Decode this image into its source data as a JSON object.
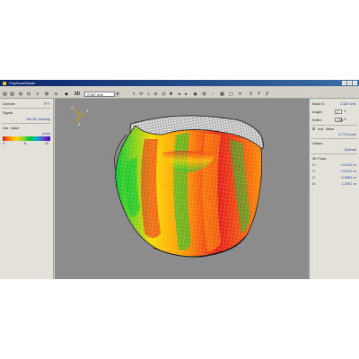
{
  "window": {
    "title": "PolyScanViewer"
  },
  "toolbar": {
    "band_select_value": "2.587 kHz",
    "axis_x": "X",
    "axis_y": "Y",
    "axis_z": "Z",
    "mode_3d": "3D"
  },
  "left_panel": {
    "domain_label": "Domain",
    "domain_value": "FFT",
    "signal_label": "Signal",
    "signal_value": "Vib 3D Velocity",
    "insl_label": "Insl. Value",
    "unit": "µm/s",
    "scale_ticks": [
      "0",
      "5",
      "10"
    ]
  },
  "right_panel": {
    "band_label": "Band 5:",
    "band_value": "2.587 kHz",
    "angle_label": "Angle:",
    "angle_value": "0°",
    "index_label": "Index:",
    "index_value": "1301",
    "insl_label": "Insl. Value",
    "insl_value": "3.779 µm/s",
    "status_label": "Status",
    "status_value": "Optimal",
    "point_label": "3D Point",
    "x_label": "X:",
    "x_value": "0.0124 m",
    "y_label": "Y:",
    "y_value": "0.0792 m",
    "z_label": "Z:",
    "z_value": "0.3964 m",
    "d_label": "D:",
    "d_value": "1.2057 m"
  },
  "viewport": {
    "axis_labels": [
      "X",
      "Y",
      "Z"
    ],
    "colors": {
      "background": "#8c8c8c",
      "mesh": "#ffffff",
      "outline": "#1a1a1a",
      "hot": "#e41a1c",
      "warm": "#ff8c00",
      "mid": "#ffd700",
      "cool": "#00c832"
    }
  }
}
